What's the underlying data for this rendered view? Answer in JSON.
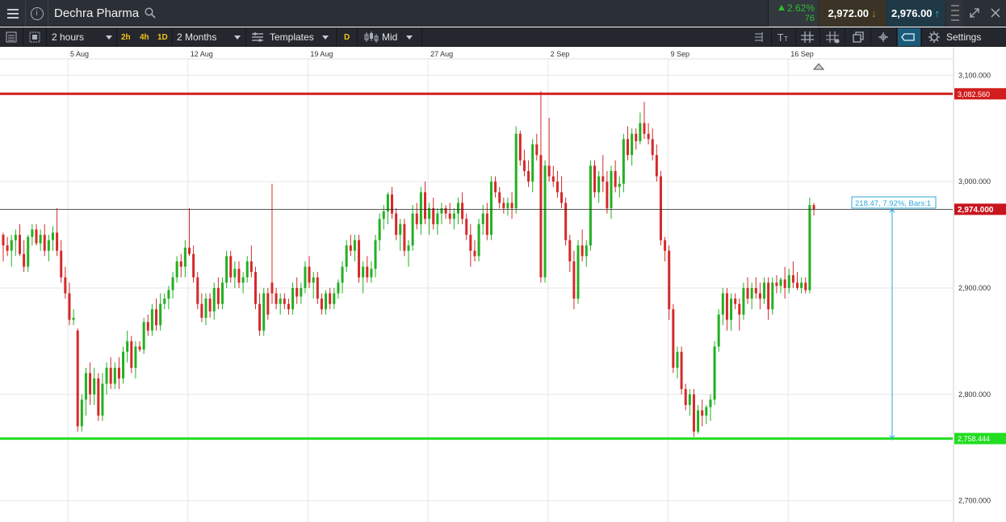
{
  "header": {
    "instrument": "Dechra Pharma",
    "change_pct": "2.62%",
    "change_points": "76",
    "sell_price": "2,972.00",
    "buy_price": "2,976.00"
  },
  "toolbar": {
    "interval": "2 hours",
    "quick_intervals": [
      "2h",
      "4h",
      "1D"
    ],
    "range": "2 Months",
    "templates": "Templates",
    "chart_type_badge": "D",
    "price_mode": "Mid",
    "settings": "Settings"
  },
  "colors": {
    "up": "#22b022",
    "down": "#d42a2a",
    "resistance_line": "#d21e1e",
    "support_line": "#22dd22",
    "measure": "#2aa8d8"
  },
  "chart_data": {
    "type": "candlestick",
    "date_labels": [
      "5 Aug",
      "12 Aug",
      "19 Aug",
      "27 Aug",
      "2 Sep",
      "9 Sep",
      "16 Sep"
    ],
    "y_ticks": [
      "3,100.000",
      "3,000.000",
      "2,900.000",
      "2,800.000",
      "2,700.000"
    ],
    "y_tick_values": [
      3100,
      3000,
      2900,
      2800,
      2700
    ],
    "ylim": [
      2680,
      3126
    ],
    "current_price": 2974,
    "current_price_label": "2,974.000",
    "resistance": 3082.56,
    "resistance_label": "3,082.560",
    "support": 2758.444,
    "support_label": "2,758.444",
    "measure_label": "218.47, 7.92%, Bars:1",
    "candles": [
      [
        2950,
        2952,
        2925,
        2940
      ],
      [
        2940,
        2948,
        2930,
        2935
      ],
      [
        2935,
        2950,
        2920,
        2945
      ],
      [
        2945,
        2955,
        2930,
        2950
      ],
      [
        2950,
        2960,
        2930,
        2932
      ],
      [
        2932,
        2945,
        2915,
        2920
      ],
      [
        2920,
        2950,
        2915,
        2948
      ],
      [
        2948,
        2960,
        2940,
        2955
      ],
      [
        2955,
        2960,
        2940,
        2942
      ],
      [
        2942,
        2955,
        2935,
        2950
      ],
      [
        2950,
        2960,
        2930,
        2935
      ],
      [
        2935,
        2950,
        2925,
        2945
      ],
      [
        2945,
        2958,
        2935,
        2952
      ],
      [
        2952,
        2975,
        2930,
        2935
      ],
      [
        2935,
        2945,
        2905,
        2910
      ],
      [
        2910,
        2920,
        2890,
        2895
      ],
      [
        2895,
        2905,
        2865,
        2870
      ],
      [
        2870,
        2880,
        2865,
        2872
      ],
      [
        2860,
        2862,
        2765,
        2770
      ],
      [
        2770,
        2800,
        2765,
        2795
      ],
      [
        2795,
        2825,
        2780,
        2820
      ],
      [
        2820,
        2830,
        2790,
        2800
      ],
      [
        2800,
        2825,
        2790,
        2815
      ],
      [
        2815,
        2820,
        2775,
        2780
      ],
      [
        2780,
        2820,
        2775,
        2810
      ],
      [
        2810,
        2830,
        2800,
        2825
      ],
      [
        2825,
        2835,
        2805,
        2810
      ],
      [
        2810,
        2830,
        2805,
        2825
      ],
      [
        2825,
        2835,
        2805,
        2815
      ],
      [
        2815,
        2845,
        2810,
        2840
      ],
      [
        2840,
        2860,
        2830,
        2850
      ],
      [
        2850,
        2855,
        2820,
        2825
      ],
      [
        2825,
        2850,
        2815,
        2845
      ],
      [
        2845,
        2850,
        2840,
        2842
      ],
      [
        2842,
        2872,
        2838,
        2868
      ],
      [
        2868,
        2875,
        2855,
        2860
      ],
      [
        2860,
        2885,
        2855,
        2880
      ],
      [
        2880,
        2890,
        2860,
        2865
      ],
      [
        2865,
        2895,
        2860,
        2885
      ],
      [
        2885,
        2895,
        2880,
        2890
      ],
      [
        2890,
        2902,
        2880,
        2898
      ],
      [
        2898,
        2915,
        2890,
        2910
      ],
      [
        2910,
        2930,
        2905,
        2925
      ],
      [
        2925,
        2932,
        2910,
        2920
      ],
      [
        2920,
        2945,
        2910,
        2938
      ],
      [
        2938,
        2975,
        2930,
        2932
      ],
      [
        2932,
        2940,
        2905,
        2910
      ],
      [
        2910,
        2915,
        2880,
        2885
      ],
      [
        2885,
        2895,
        2868,
        2872
      ],
      [
        2872,
        2895,
        2865,
        2890
      ],
      [
        2890,
        2895,
        2872,
        2878
      ],
      [
        2878,
        2905,
        2870,
        2900
      ],
      [
        2900,
        2910,
        2880,
        2885
      ],
      [
        2885,
        2910,
        2880,
        2905
      ],
      [
        2905,
        2935,
        2900,
        2930
      ],
      [
        2930,
        2935,
        2905,
        2910
      ],
      [
        2910,
        2925,
        2900,
        2918
      ],
      [
        2918,
        2925,
        2900,
        2905
      ],
      [
        2905,
        2915,
        2895,
        2910
      ],
      [
        2910,
        2930,
        2905,
        2925
      ],
      [
        2925,
        2940,
        2910,
        2915
      ],
      [
        2915,
        2920,
        2880,
        2885
      ],
      [
        2885,
        2895,
        2855,
        2860
      ],
      [
        2860,
        2900,
        2855,
        2895
      ],
      [
        2895,
        2900,
        2870,
        2875
      ],
      [
        2905,
        2998,
        2885,
        2895
      ],
      [
        2895,
        2900,
        2880,
        2885
      ],
      [
        2885,
        2895,
        2875,
        2890
      ],
      [
        2890,
        2895,
        2880,
        2885
      ],
      [
        2885,
        2890,
        2875,
        2880
      ],
      [
        2880,
        2905,
        2875,
        2900
      ],
      [
        2900,
        2910,
        2885,
        2892
      ],
      [
        2892,
        2905,
        2885,
        2900
      ],
      [
        2900,
        2925,
        2895,
        2920
      ],
      [
        2920,
        2930,
        2900,
        2905
      ],
      [
        2905,
        2915,
        2890,
        2910
      ],
      [
        2910,
        2915,
        2885,
        2890
      ],
      [
        2890,
        2895,
        2875,
        2880
      ],
      [
        2880,
        2898,
        2875,
        2895
      ],
      [
        2895,
        2900,
        2880,
        2885
      ],
      [
        2885,
        2900,
        2880,
        2895
      ],
      [
        2895,
        2908,
        2890,
        2905
      ],
      [
        2905,
        2925,
        2895,
        2920
      ],
      [
        2920,
        2945,
        2915,
        2940
      ],
      [
        2940,
        2950,
        2930,
        2935
      ],
      [
        2935,
        2950,
        2925,
        2945
      ],
      [
        2945,
        2950,
        2905,
        2910
      ],
      [
        2910,
        2925,
        2895,
        2920
      ],
      [
        2920,
        2930,
        2905,
        2910
      ],
      [
        2910,
        2925,
        2905,
        2918
      ],
      [
        2918,
        2950,
        2910,
        2945
      ],
      [
        2945,
        2970,
        2935,
        2965
      ],
      [
        2965,
        2978,
        2955,
        2972
      ],
      [
        2972,
        2990,
        2960,
        2988
      ],
      [
        2988,
        2995,
        2965,
        2970
      ],
      [
        2970,
        2975,
        2945,
        2950
      ],
      [
        2950,
        2965,
        2935,
        2960
      ],
      [
        2960,
        2965,
        2930,
        2935
      ],
      [
        2935,
        2945,
        2920,
        2940
      ],
      [
        2940,
        2978,
        2935,
        2970
      ],
      [
        2970,
        2980,
        2955,
        2960
      ],
      [
        2960,
        2995,
        2950,
        2990
      ],
      [
        2990,
        3000,
        2960,
        2965
      ],
      [
        2965,
        2980,
        2950,
        2975
      ],
      [
        2975,
        2985,
        2955,
        2960
      ],
      [
        2960,
        2975,
        2950,
        2970
      ],
      [
        2970,
        2980,
        2960,
        2975
      ],
      [
        2975,
        2978,
        2965,
        2970
      ],
      [
        2970,
        2980,
        2960,
        2965
      ],
      [
        2965,
        2975,
        2955,
        2970
      ],
      [
        2970,
        2985,
        2960,
        2980
      ],
      [
        2980,
        2990,
        2960,
        2965
      ],
      [
        2965,
        2970,
        2945,
        2950
      ],
      [
        2950,
        2960,
        2920,
        2935
      ],
      [
        2935,
        2945,
        2925,
        2930
      ],
      [
        2930,
        2965,
        2925,
        2960
      ],
      [
        2960,
        2978,
        2950,
        2970
      ],
      [
        2970,
        2980,
        2945,
        2950
      ],
      [
        2950,
        3005,
        2945,
        3000
      ],
      [
        3000,
        3005,
        2985,
        2990
      ],
      [
        2990,
        2995,
        2975,
        2980
      ],
      [
        2980,
        2985,
        2970,
        2975
      ],
      [
        2975,
        2985,
        2968,
        2980
      ],
      [
        2980,
        2990,
        2965,
        2975
      ],
      [
        2975,
        3052,
        2970,
        3045
      ],
      [
        3045,
        3048,
        3015,
        3020
      ],
      [
        3020,
        3030,
        3005,
        3010
      ],
      [
        3010,
        3020,
        2995,
        3000
      ],
      [
        3000,
        3040,
        2990,
        3035
      ],
      [
        3035,
        3045,
        3020,
        3025
      ],
      [
        3025,
        3085,
        2905,
        2910
      ],
      [
        2910,
        3020,
        2905,
        3015
      ],
      [
        3015,
        3060,
        3000,
        3005
      ],
      [
        3005,
        3015,
        2995,
        3000
      ],
      [
        3000,
        3010,
        2985,
        2990
      ],
      [
        2990,
        3005,
        2975,
        2980
      ],
      [
        2980,
        2985,
        2940,
        2945
      ],
      [
        2945,
        2950,
        2915,
        2925
      ],
      [
        2925,
        2935,
        2880,
        2890
      ],
      [
        2890,
        2945,
        2885,
        2940
      ],
      [
        2940,
        2955,
        2925,
        2930
      ],
      [
        2930,
        2945,
        2920,
        2940
      ],
      [
        2940,
        3020,
        2935,
        3015
      ],
      [
        3015,
        3020,
        2985,
        2990
      ],
      [
        2990,
        3010,
        2980,
        3005
      ],
      [
        3005,
        3025,
        2990,
        3000
      ],
      [
        3000,
        3010,
        2970,
        2975
      ],
      [
        2975,
        3015,
        2965,
        3010
      ],
      [
        3010,
        3020,
        2990,
        2995
      ],
      [
        2995,
        3005,
        2985,
        2998
      ],
      [
        2998,
        3045,
        2990,
        3040
      ],
      [
        3040,
        3052,
        3020,
        3025
      ],
      [
        3025,
        3050,
        3015,
        3045
      ],
      [
        3045,
        3050,
        3030,
        3038
      ],
      [
        3038,
        3065,
        3035,
        3055
      ],
      [
        3055,
        3075,
        3040,
        3045
      ],
      [
        3045,
        3055,
        3035,
        3040
      ],
      [
        3040,
        3050,
        3020,
        3025
      ],
      [
        3025,
        3035,
        3000,
        3005
      ],
      [
        3005,
        3010,
        2940,
        2945
      ],
      [
        2945,
        2948,
        2925,
        2935
      ],
      [
        2935,
        2940,
        2870,
        2880
      ],
      [
        2880,
        2885,
        2820,
        2825
      ],
      [
        2825,
        2845,
        2815,
        2840
      ],
      [
        2840,
        2845,
        2800,
        2805
      ],
      [
        2805,
        2810,
        2785,
        2790
      ],
      [
        2790,
        2805,
        2780,
        2800
      ],
      [
        2800,
        2805,
        2760,
        2765
      ],
      [
        2765,
        2790,
        2763,
        2785
      ],
      [
        2785,
        2795,
        2770,
        2780
      ],
      [
        2780,
        2790,
        2772,
        2788
      ],
      [
        2788,
        2800,
        2775,
        2795
      ],
      [
        2795,
        2850,
        2790,
        2845
      ],
      [
        2845,
        2880,
        2840,
        2875
      ],
      [
        2875,
        2900,
        2865,
        2895
      ],
      [
        2895,
        2900,
        2860,
        2870
      ],
      [
        2870,
        2895,
        2860,
        2890
      ],
      [
        2890,
        2895,
        2880,
        2885
      ],
      [
        2885,
        2890,
        2860,
        2875
      ],
      [
        2875,
        2905,
        2870,
        2900
      ],
      [
        2900,
        2910,
        2885,
        2890
      ],
      [
        2890,
        2905,
        2880,
        2900
      ],
      [
        2900,
        2910,
        2890,
        2895
      ],
      [
        2895,
        2905,
        2880,
        2890
      ],
      [
        2890,
        2910,
        2885,
        2905
      ],
      [
        2905,
        2910,
        2870,
        2880
      ],
      [
        2880,
        2910,
        2875,
        2905
      ],
      [
        2905,
        2912,
        2895,
        2902
      ],
      [
        2902,
        2910,
        2895,
        2908
      ],
      [
        2908,
        2920,
        2890,
        2900
      ],
      [
        2900,
        2918,
        2895,
        2912
      ],
      [
        2912,
        2925,
        2900,
        2905
      ],
      [
        2905,
        2915,
        2898,
        2900
      ],
      [
        2900,
        2910,
        2895,
        2905
      ],
      [
        2905,
        2910,
        2895,
        2898
      ],
      [
        2898,
        2985,
        2895,
        2978
      ],
      [
        2978,
        2980,
        2968,
        2974
      ]
    ]
  }
}
